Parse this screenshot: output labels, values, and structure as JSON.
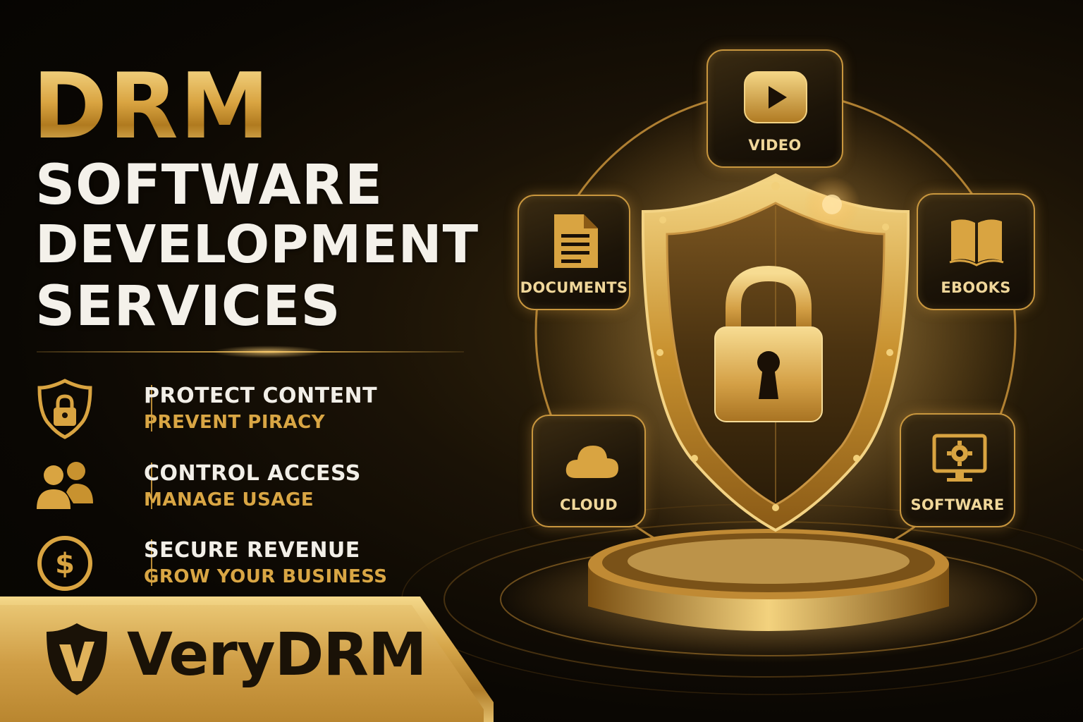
{
  "headline": {
    "drm": "DRM",
    "line1": "SOFTWARE",
    "line2": "DEVELOPMENT",
    "line3": "SERVICES"
  },
  "features": [
    {
      "icon": "shield-lock-icon",
      "title": "PROTECT CONTENT",
      "subtitle": "PREVENT PIRACY"
    },
    {
      "icon": "users-icon",
      "title": "CONTROL ACCESS",
      "subtitle": "MANAGE USAGE"
    },
    {
      "icon": "dollar-coin-icon",
      "title": "SECURE REVENUE",
      "subtitle": "GROW YOUR BUSINESS"
    }
  ],
  "brand": {
    "name": "VeryDRM",
    "logo_icon": "v-shield-logo-icon"
  },
  "tiles": {
    "video": {
      "label": "VIDEO",
      "icon": "play-icon"
    },
    "documents": {
      "label": "DOCUMENTS",
      "icon": "document-icon"
    },
    "ebooks": {
      "label": "EBOOKS",
      "icon": "open-book-icon"
    },
    "cloud": {
      "label": "CLOUD",
      "icon": "cloud-icon"
    },
    "software": {
      "label": "SOFTWARE",
      "icon": "monitor-gear-icon"
    }
  },
  "hero_icon": "shield-padlock-icon",
  "colors": {
    "gold": "#d9a441",
    "gold_light": "#f6d98a",
    "dark": "#0a0703",
    "white": "#f4f1ea"
  }
}
